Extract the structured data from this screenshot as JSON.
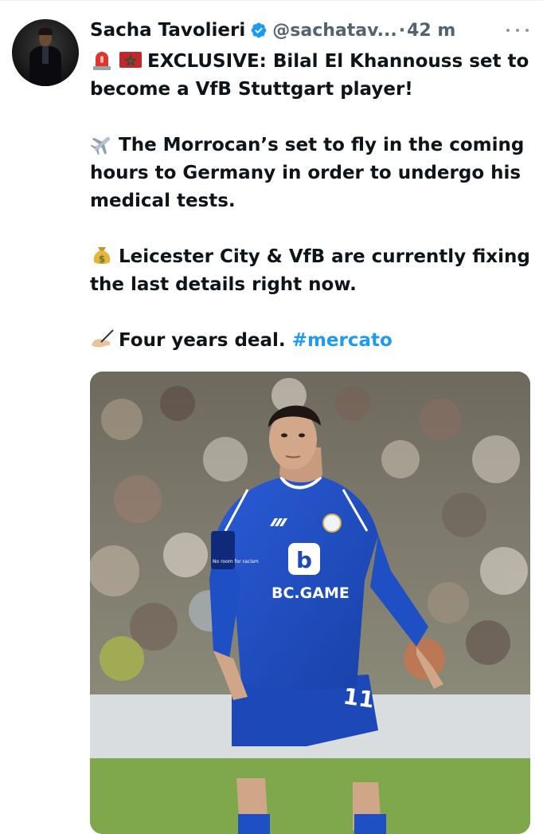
{
  "tweet": {
    "author_name": "Sacha Tavolieri",
    "handle": "@sachatav...",
    "separator": "·",
    "time_ago": "42 m",
    "lines": [
      {
        "icons": [
          "siren-emoji",
          "morocco-flag-emoji"
        ],
        "text": "EXCLUSIVE: Bilal El Khannouss set to become a VfB Stuttgart player!"
      },
      {
        "icons": [
          "airplane-emoji"
        ],
        "text": "The Morrocan’s set to fly in the coming hours to Germany in order to undergo his medical tests."
      },
      {
        "icons": [
          "money-bag-emoji"
        ],
        "text": "Leicester City & VfB are currently fixing the last details right now."
      },
      {
        "icons": [
          "writing-hand-emoji"
        ],
        "text": "Four years deal.",
        "hashtag": "#mercato"
      }
    ],
    "media": {
      "jersey_sponsor": "BC.GAME",
      "shorts_number": "11",
      "sleeve_patch": "No room for racism"
    }
  },
  "colors": {
    "text": "#0f1419",
    "secondary": "#536471",
    "link": "#1d9bf0",
    "verified": "#1d9bf0",
    "kit_blue": "#1f4fc4"
  }
}
